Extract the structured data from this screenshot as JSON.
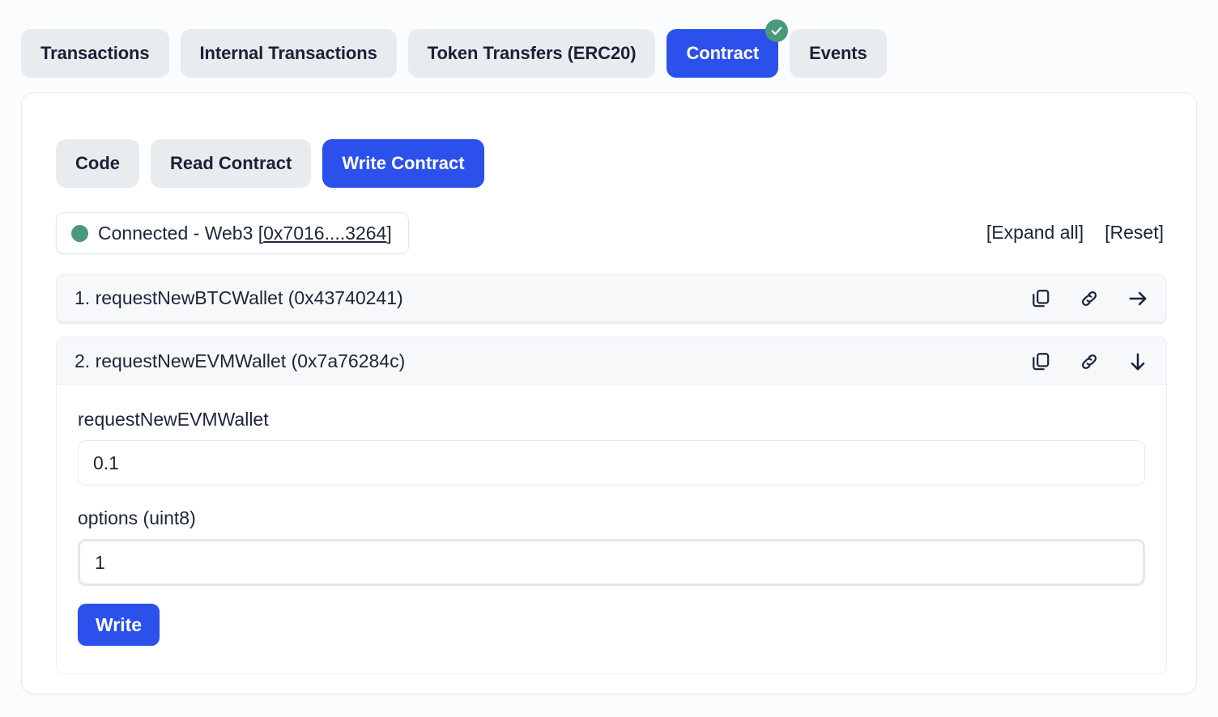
{
  "colors": {
    "accent_blue": "#2b50ec",
    "inactive_tab_bg": "#e9ecef",
    "text_dark": "#1c2639",
    "connected_green": "#49997d",
    "badge_green": "#49997d",
    "panel_header_bg": "#f7f8fa",
    "card_bg": "#ffffff",
    "page_bg": "#fbfcfd"
  },
  "tabs": [
    {
      "label": "Transactions",
      "active": false,
      "badge": null
    },
    {
      "label": "Internal Transactions",
      "active": false,
      "badge": null
    },
    {
      "label": "Token Transfers (ERC20)",
      "active": false,
      "badge": null
    },
    {
      "label": "Contract",
      "active": true,
      "badge": "check-badge"
    },
    {
      "label": "Events",
      "active": false,
      "badge": null
    }
  ],
  "subtabs": [
    {
      "label": "Code",
      "active": false
    },
    {
      "label": "Read Contract",
      "active": false
    },
    {
      "label": "Write Contract",
      "active": true
    }
  ],
  "connection": {
    "status_prefix": "Connected - Web3 [",
    "address": "0x7016....3264",
    "status_suffix": "]",
    "dot_icon": "status-dot-icon",
    "expand_all_label": "[Expand all]",
    "reset_label": "[Reset]"
  },
  "functions": [
    {
      "title": "1. requestNewBTCWallet (0x43740241)",
      "expanded": false,
      "toggle_icon": "arrow-right-icon",
      "copy_icon": "copy-icon",
      "link_icon": "link-icon"
    },
    {
      "title": "2. requestNewEVMWallet (0x7a76284c)",
      "expanded": true,
      "toggle_icon": "arrow-down-icon",
      "copy_icon": "copy-icon",
      "link_icon": "link-icon",
      "fields": [
        {
          "label": "requestNewEVMWallet",
          "value": "0.1",
          "placeholder": "",
          "focused": false
        },
        {
          "label": "options (uint8)",
          "value": "1",
          "placeholder": "",
          "focused": true
        }
      ],
      "submit_label": "Write"
    }
  ]
}
